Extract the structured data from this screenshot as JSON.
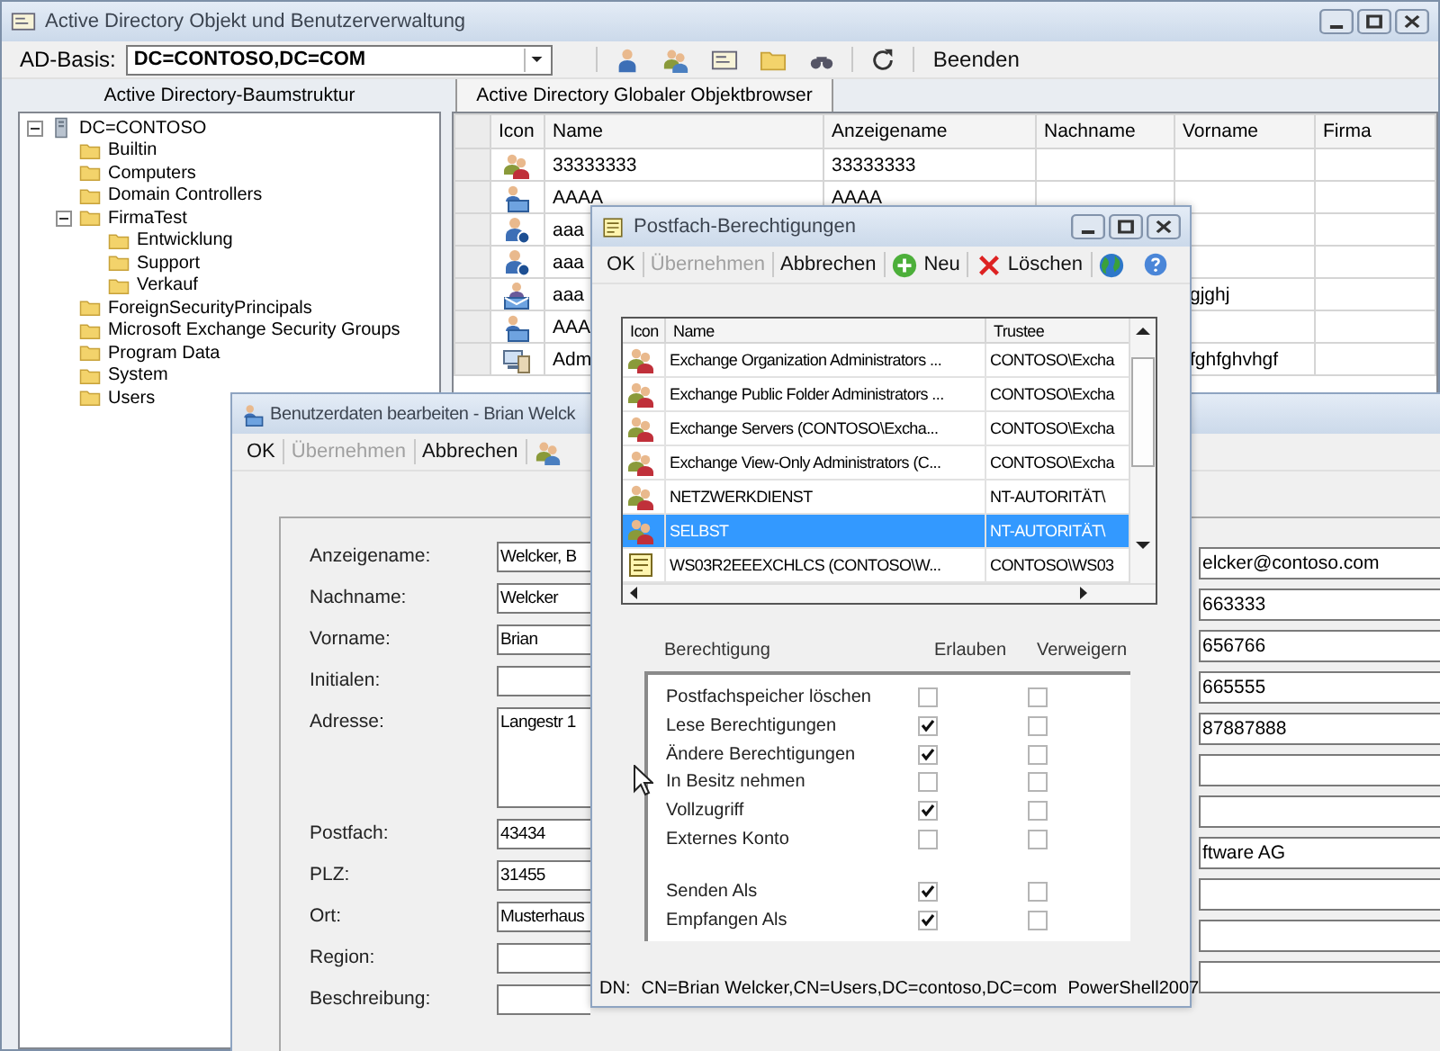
{
  "main_window": {
    "title": "Active Directory Objekt und Benutzerverwaltung",
    "toolbar": {
      "base_label": "AD-Basis:",
      "base_value": "DC=CONTOSO,DC=COM",
      "exit_label": "Beenden"
    },
    "tree_pane": {
      "title": "Active Directory-Baumstruktur"
    },
    "browser_pane": {
      "tab": "Active Directory Globaler Objektbrowser"
    },
    "tree": [
      {
        "label": "DC=CONTOSO",
        "expanded": true,
        "children": [
          {
            "label": "Builtin"
          },
          {
            "label": "Computers"
          },
          {
            "label": "Domain Controllers"
          },
          {
            "label": "FirmaTest",
            "expanded": true,
            "children": [
              {
                "label": "Entwicklung"
              },
              {
                "label": "Support"
              },
              {
                "label": "Verkauf"
              }
            ]
          },
          {
            "label": "ForeignSecurityPrincipals"
          },
          {
            "label": "Microsoft Exchange Security Groups"
          },
          {
            "label": "Program Data"
          },
          {
            "label": "System"
          },
          {
            "label": "Users"
          }
        ]
      }
    ],
    "table": {
      "columns": [
        "Icon",
        "Name",
        "Anzeigename",
        "Nachname",
        "Vorname",
        "Firma"
      ],
      "rows": [
        {
          "kind": "group",
          "name": "33333333",
          "display_name": "33333333"
        },
        {
          "kind": "mailbox-user",
          "name": "AAAA",
          "display_name": "AAAA"
        },
        {
          "kind": "user",
          "name": "aaa"
        },
        {
          "kind": "user",
          "name": "aaa"
        },
        {
          "kind": "contact",
          "name": "aaa",
          "first_name": "gjghj"
        },
        {
          "kind": "mailbox-user",
          "name": "AAA"
        },
        {
          "kind": "computer",
          "name": "Adm",
          "first_name": "fghfghvhgf"
        }
      ]
    }
  },
  "user_editor": {
    "title": "Benutzerdaten bearbeiten - Brian Welck",
    "toolbar": [
      {
        "kind": "text",
        "label": "OK",
        "disabled": false
      },
      {
        "kind": "text",
        "label": "Übernehmen",
        "disabled": true
      },
      {
        "kind": "text",
        "label": "Abbrechen",
        "disabled": false
      },
      {
        "kind": "group",
        "disabled": false
      }
    ],
    "fields": [
      {
        "kind": "line",
        "label": "Anzeigename:",
        "value": "Welcker, B"
      },
      {
        "kind": "line",
        "label": "Nachname:",
        "value": "Welcker"
      },
      {
        "kind": "line",
        "label": "Vorname:",
        "value": "Brian"
      },
      {
        "kind": "line",
        "label": "Initialen:"
      },
      {
        "kind": "multiline",
        "label": "Adresse:",
        "value": "Langestr 1"
      },
      {
        "kind": "line",
        "label": "Postfach:",
        "value": "43434"
      },
      {
        "kind": "line",
        "label": "PLZ:",
        "value": "31455"
      },
      {
        "kind": "line",
        "label": "Ort:",
        "value": "Musterhaus"
      },
      {
        "kind": "line",
        "label": "Region:"
      },
      {
        "kind": "line",
        "label": "Beschreibung:"
      }
    ],
    "right_fields": [
      {
        "kind": "line",
        "value": "elcker@contoso.com"
      },
      {
        "kind": "line",
        "value": "663333"
      },
      {
        "kind": "line",
        "value": "656766"
      },
      {
        "kind": "line",
        "value": "665555"
      },
      {
        "kind": "line",
        "value": "87887888"
      },
      {
        "kind": "line"
      },
      {
        "kind": "line"
      },
      {
        "kind": "line",
        "value": "ftware AG"
      },
      {
        "kind": "line"
      },
      {
        "kind": "line"
      },
      {
        "kind": "line"
      }
    ]
  },
  "mailbox_permissions": {
    "title": "Postfach-Berechtigungen",
    "toolbar": [
      {
        "kind": "text",
        "label": "OK",
        "disabled": false
      },
      {
        "kind": "text",
        "label": "Übernehmen",
        "disabled": true
      },
      {
        "kind": "text",
        "label": "Abbrechen",
        "disabled": false
      },
      {
        "kind": "add",
        "label": "Neu",
        "disabled": false
      },
      {
        "kind": "delete",
        "label": "Löschen",
        "disabled": false
      },
      {
        "kind": "globe",
        "disabled": false
      }
    ],
    "trustee_list": {
      "columns": [
        "Icon",
        "Name",
        "Trustee"
      ],
      "rows": [
        {
          "kind": "group",
          "name": "Exchange Organization Administrators ...",
          "trustee": "CONTOSO\\Excha",
          "selected": false
        },
        {
          "kind": "group",
          "name": "Exchange Public Folder Administrators ...",
          "trustee": "CONTOSO\\Excha",
          "selected": false
        },
        {
          "kind": "group",
          "name": "Exchange Servers (CONTOSO\\Excha...",
          "trustee": "CONTOSO\\Excha",
          "selected": false
        },
        {
          "kind": "group",
          "name": "Exchange View-Only Administrators (C...",
          "trustee": "CONTOSO\\Excha",
          "selected": false
        },
        {
          "kind": "group",
          "name": "NETZWERKDIENST",
          "trustee": "NT-AUTORITÄT\\",
          "selected": false
        },
        {
          "kind": "group",
          "name": "SELBST",
          "trustee": "NT-AUTORITÄT\\",
          "selected": true
        },
        {
          "kind": "note",
          "name": "WS03R2EEEXCHLCS (CONTOSO\\W...",
          "trustee": "CONTOSO\\WS03",
          "selected": false
        }
      ]
    },
    "permission_columns": [
      "Berechtigung",
      "Erlauben",
      "Verweigern"
    ],
    "permission_groups": [
      [
        {
          "name": "Postfachspeicher löschen",
          "allow": false,
          "deny": false
        },
        {
          "name": "Lese Berechtigungen",
          "allow": true,
          "deny": false
        },
        {
          "name": "Ändere Berechtigungen",
          "allow": true,
          "deny": false
        },
        {
          "name": "In Besitz nehmen",
          "allow": false,
          "deny": false
        },
        {
          "name": "Vollzugriff",
          "allow": true,
          "deny": false
        },
        {
          "name": "Externes Konto",
          "allow": false,
          "deny": false
        }
      ],
      [
        {
          "name": "Senden Als",
          "allow": true,
          "deny": false
        },
        {
          "name": "Empfangen Als",
          "allow": true,
          "deny": false
        }
      ]
    ],
    "status": {
      "dn_label": "DN:",
      "dn": "CN=Brian Welcker,CN=Users,DC=contoso,DC=com",
      "source": "PowerShell2007"
    }
  }
}
